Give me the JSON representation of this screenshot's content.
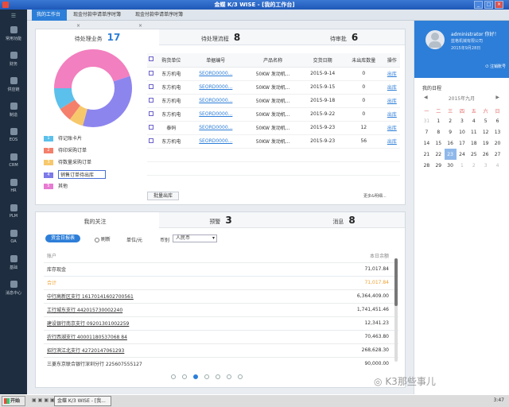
{
  "window": {
    "title": "金蝶 K/3 WISE - [我的工作台]"
  },
  "sidebar": {
    "top_icon": "☰",
    "items": [
      {
        "label": "常用功能",
        "icon": "star-icon"
      },
      {
        "label": "财务",
        "icon": "finance-icon"
      },
      {
        "label": "供应链",
        "icon": "supply-chain-icon"
      },
      {
        "label": "制造",
        "icon": "manufacturing-icon"
      },
      {
        "label": "EOS",
        "icon": "eos-icon"
      },
      {
        "label": "CRM",
        "icon": "crm-icon"
      },
      {
        "label": "HR",
        "icon": "hr-icon"
      },
      {
        "label": "PLM",
        "icon": "plm-icon"
      },
      {
        "label": "OA",
        "icon": "oa-icon"
      },
      {
        "label": "基础",
        "icon": "base-icon"
      },
      {
        "label": "消息中心",
        "icon": "message-icon"
      }
    ]
  },
  "tabs": [
    {
      "label": "我的工作台"
    },
    {
      "label": "现金付款申请单序时簿"
    },
    {
      "label": "现金付款申请单序时簿"
    }
  ],
  "top_panel": {
    "tabs": [
      {
        "label": "待处理业务",
        "count": "17"
      },
      {
        "label": "待处理流程",
        "count": "8"
      },
      {
        "label": "待审批",
        "count": "6"
      }
    ],
    "legend": [
      {
        "num": "1",
        "label": "待记账卡片",
        "color": "#5bc0eb"
      },
      {
        "num": "2",
        "label": "待印采购订单",
        "color": "#f47f6b"
      },
      {
        "num": "3",
        "label": "待数量采购订单",
        "color": "#f7c86b"
      },
      {
        "num": "4",
        "label": "销售订单待出库",
        "color": "#7c79e8"
      },
      {
        "num": "5",
        "label": "其他",
        "color": "#e77bd2"
      }
    ],
    "columns": [
      "",
      "购货单位",
      "单据编号",
      "产品名称",
      "交货日期",
      "未出库数量",
      "操作"
    ],
    "rows": [
      {
        "unit": "东方机电",
        "code": "SEORD0000...",
        "product": "50KW 发动机...",
        "date": "2015-9-14",
        "qty": "0",
        "op": "出库"
      },
      {
        "unit": "东方机电",
        "code": "SEORD0000...",
        "product": "50KW 发动机...",
        "date": "2015-9-15",
        "qty": "0",
        "op": "出库"
      },
      {
        "unit": "东方机电",
        "code": "SEORD0000...",
        "product": "50KW 发动机...",
        "date": "2015-9-18",
        "qty": "0",
        "op": "出库"
      },
      {
        "unit": "东方机电",
        "code": "SEORD0000...",
        "product": "50KW 发动机...",
        "date": "2015-9-22",
        "qty": "0",
        "op": "出库"
      },
      {
        "unit": "泰码",
        "code": "SEORD0000...",
        "product": "50KW 发动机...",
        "date": "2015-9-23",
        "qty": "12",
        "op": "出库"
      },
      {
        "unit": "东方机电",
        "code": "SEORD0000...",
        "product": "50KW 发动机...",
        "date": "2015-9-23",
        "qty": "56",
        "op": "出库"
      }
    ],
    "batch_button": "批量出库",
    "more_link": "更多&明细..."
  },
  "bottom_panel": {
    "tabs": [
      {
        "label": "我的关注",
        "count": ""
      },
      {
        "label": "预警",
        "count": "3"
      },
      {
        "label": "消息",
        "count": "8"
      }
    ],
    "report_button": "资金日报表",
    "refresh_label": "刷新",
    "unit_label": "单位/元",
    "currency_label": "币别",
    "currency_value": "人民币",
    "col_account": "账户",
    "col_balance": "本日余额",
    "rows": [
      {
        "account": "库存现金",
        "balance": "71,017.84",
        "highlight": false
      },
      {
        "account": "合计",
        "balance": "71,017.84",
        "highlight": true
      },
      {
        "account": "中行高新区支行 16170141602700561",
        "balance": "6,364,409.00",
        "highlight": false
      },
      {
        "account": "工行城东支行 442015730002240",
        "balance": "1,741,451.46",
        "highlight": false
      },
      {
        "account": "建设银行南京支行 09201301002259",
        "balance": "12,341.23",
        "highlight": false
      },
      {
        "account": "农行西湖支行 40001180537068 84",
        "balance": "70,463.80",
        "highlight": false
      },
      {
        "account": "招行滨江北支行 42720147061293",
        "balance": "268,628.30",
        "highlight": false
      },
      {
        "account": "三菱东京联合银行深圳分行 225607555127",
        "balance": "90,000.00",
        "highlight": false
      }
    ]
  },
  "profile": {
    "name": "administrator 你好！",
    "company": "蓝格机械有限公司",
    "date": "2015年9月28日",
    "logout": "注销账号"
  },
  "calendar": {
    "title": "我的日程",
    "month_label": "2015年九月",
    "weekdays": [
      "一",
      "二",
      "三",
      "四",
      "五",
      "六",
      "日"
    ],
    "weeks": [
      [
        "31",
        "1",
        "2",
        "3",
        "4",
        "5",
        "6"
      ],
      [
        "7",
        "8",
        "9",
        "10",
        "11",
        "12",
        "13"
      ],
      [
        "14",
        "15",
        "16",
        "17",
        "18",
        "19",
        "20"
      ],
      [
        "21",
        "22",
        "23",
        "24",
        "25",
        "26",
        "27"
      ],
      [
        "28",
        "29",
        "30",
        "1",
        "2",
        "3",
        "4"
      ]
    ],
    "today": "23"
  },
  "taskbar": {
    "start": "开始",
    "app": "金蝶 K/3 WISE - [我...",
    "clock": "3:47",
    "watermark": "K3那些事儿"
  }
}
